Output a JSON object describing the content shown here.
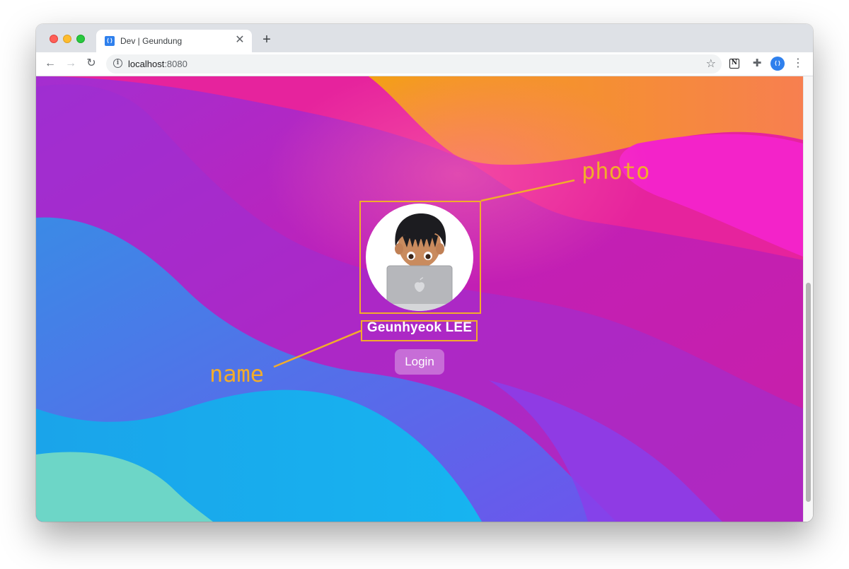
{
  "tab": {
    "title": "Dev | Geundung",
    "favicon_glyph": "⟨⟩"
  },
  "address_bar": {
    "host": "localhost",
    "port": ":8080"
  },
  "profile": {
    "name": "Geunhyeok LEE",
    "login_label": "Login"
  },
  "annotations": {
    "photo_label": "photo",
    "name_label": "name"
  },
  "icons": {
    "back": "arrow-left-icon",
    "forward": "arrow-right-icon",
    "reload": "reload-icon",
    "info": "info-icon",
    "star": "star-icon",
    "notion": "notion-icon",
    "extensions": "puzzle-icon",
    "profile": "profile-icon",
    "menu": "kebab-menu-icon",
    "close": "close-icon",
    "new_tab": "plus-icon"
  },
  "colors": {
    "annotation": "#f2ac2b",
    "favicon": "#2f80ed"
  }
}
